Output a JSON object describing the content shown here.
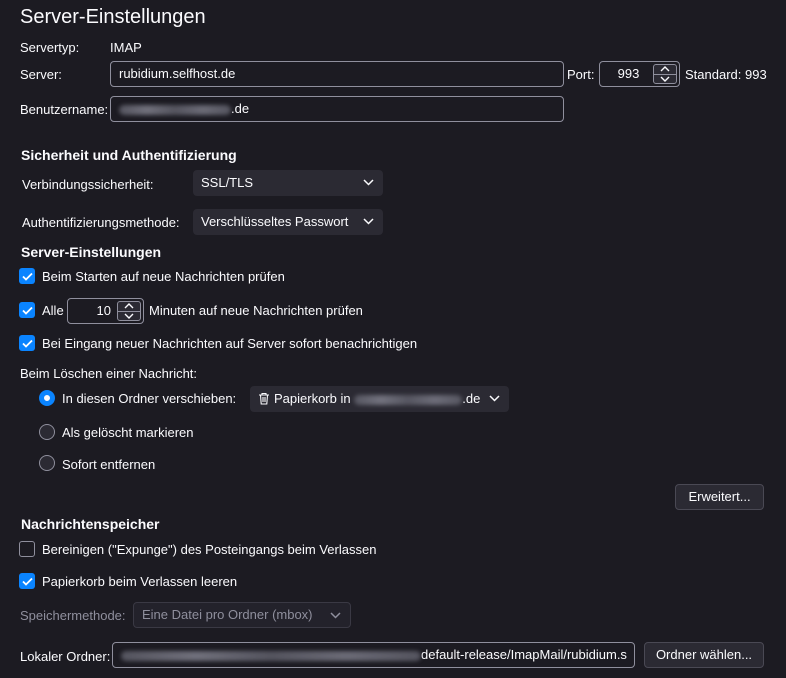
{
  "page": {
    "title": "Server-Einstellungen"
  },
  "server": {
    "type_label": "Servertyp:",
    "type_value": "IMAP",
    "server_label": "Server:",
    "server_value": "rubidium.selfhost.de",
    "port_label": "Port:",
    "port_value": "993",
    "standard_label": "Standard: 993",
    "username_label": "Benutzername:",
    "username_suffix": ".de"
  },
  "security": {
    "heading": "Sicherheit und Authentifizierung",
    "connection_label": "Verbindungssicherheit:",
    "connection_value": "SSL/TLS",
    "auth_label": "Authentifizierungsmethode:",
    "auth_value": "Verschlüsseltes Passwort"
  },
  "server_settings": {
    "heading": "Server-Einstellungen",
    "check_on_start": {
      "label": "Beim Starten auf neue Nachrichten prüfen",
      "checked": true
    },
    "check_every": {
      "prefix": "Alle",
      "value": "10",
      "suffix": "Minuten auf neue Nachrichten prüfen",
      "checked": true
    },
    "notify": {
      "label": "Bei Eingang neuer Nachrichten auf Server sofort benachrichtigen",
      "checked": true
    },
    "delete_label": "Beim Löschen einer Nachricht:",
    "delete_options": [
      {
        "label": "In diesen Ordner verschieben:",
        "selected": true
      },
      {
        "label": "Als gelöscht markieren",
        "selected": false
      },
      {
        "label": "Sofort entfernen",
        "selected": false
      }
    ],
    "trash_prefix": "Papierkorb in",
    "trash_suffix": ".de",
    "advanced_button": "Erweitert..."
  },
  "storage": {
    "heading": "Nachrichtenspeicher",
    "expunge": {
      "label": "Bereinigen (\"Expunge\") des Posteingangs beim Verlassen",
      "checked": false
    },
    "empty_trash": {
      "label": "Papierkorb beim Verlassen leeren",
      "checked": true
    },
    "method_label": "Speichermethode:",
    "method_value": "Eine Datei pro Ordner (mbox)",
    "local_folder_label": "Lokaler Ordner:",
    "local_folder_suffix": "default-release/ImapMail/rubidium.s",
    "choose_folder_button": "Ordner wählen..."
  },
  "icons": {
    "checkmark": "checkmark-icon",
    "chevron": "chevron-down-icon",
    "trash": "trash-icon",
    "spin_up": "spin-up-icon",
    "spin_down": "spin-down-icon"
  },
  "colors": {
    "background": "#1c1b22",
    "accent": "#0a84ff",
    "control": "#2b2a33",
    "border": "#8f8f9d"
  }
}
